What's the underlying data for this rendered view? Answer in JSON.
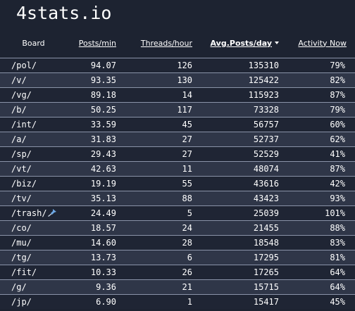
{
  "site": {
    "title": "4stats.io"
  },
  "columns": {
    "board": "Board",
    "posts_min": "Posts/min",
    "threads_hour": "Threads/hour",
    "avg_posts_day": "Avg.Posts/day",
    "activity_now": "Activity Now"
  },
  "sort": {
    "column": "avg_posts_day",
    "direction": "desc",
    "icon": "caret-down-icon"
  },
  "rows": [
    {
      "board": "/pol/",
      "posts_min": "94.07",
      "threads_hour": "126",
      "avg_posts_day": "135310",
      "activity_now": "79%"
    },
    {
      "board": "/v/",
      "posts_min": "93.35",
      "threads_hour": "130",
      "avg_posts_day": "125422",
      "activity_now": "82%"
    },
    {
      "board": "/vg/",
      "posts_min": "89.18",
      "threads_hour": "14",
      "avg_posts_day": "115923",
      "activity_now": "87%"
    },
    {
      "board": "/b/",
      "posts_min": "50.25",
      "threads_hour": "117",
      "avg_posts_day": "73328",
      "activity_now": "79%"
    },
    {
      "board": "/int/",
      "posts_min": "33.59",
      "threads_hour": "45",
      "avg_posts_day": "56757",
      "activity_now": "60%"
    },
    {
      "board": "/a/",
      "posts_min": "31.83",
      "threads_hour": "27",
      "avg_posts_day": "52737",
      "activity_now": "62%"
    },
    {
      "board": "/sp/",
      "posts_min": "29.43",
      "threads_hour": "27",
      "avg_posts_day": "52529",
      "activity_now": "41%"
    },
    {
      "board": "/vt/",
      "posts_min": "42.63",
      "threads_hour": "11",
      "avg_posts_day": "48074",
      "activity_now": "87%"
    },
    {
      "board": "/biz/",
      "posts_min": "19.19",
      "threads_hour": "55",
      "avg_posts_day": "43616",
      "activity_now": "42%"
    },
    {
      "board": "/tv/",
      "posts_min": "35.13",
      "threads_hour": "88",
      "avg_posts_day": "43423",
      "activity_now": "93%"
    },
    {
      "board": "/trash/",
      "posts_min": "24.49",
      "threads_hour": "5",
      "avg_posts_day": "25039",
      "activity_now": "101%",
      "icon": "pushpin-icon"
    },
    {
      "board": "/co/",
      "posts_min": "18.57",
      "threads_hour": "24",
      "avg_posts_day": "21455",
      "activity_now": "88%"
    },
    {
      "board": "/mu/",
      "posts_min": "14.60",
      "threads_hour": "28",
      "avg_posts_day": "18548",
      "activity_now": "83%"
    },
    {
      "board": "/tg/",
      "posts_min": "13.73",
      "threads_hour": "6",
      "avg_posts_day": "17295",
      "activity_now": "81%"
    },
    {
      "board": "/fit/",
      "posts_min": "10.33",
      "threads_hour": "26",
      "avg_posts_day": "17265",
      "activity_now": "64%"
    },
    {
      "board": "/g/",
      "posts_min": "9.36",
      "threads_hour": "21",
      "avg_posts_day": "15715",
      "activity_now": "64%"
    },
    {
      "board": "/jp/",
      "posts_min": "6.90",
      "threads_hour": "1",
      "avg_posts_day": "15417",
      "activity_now": "45%"
    }
  ]
}
